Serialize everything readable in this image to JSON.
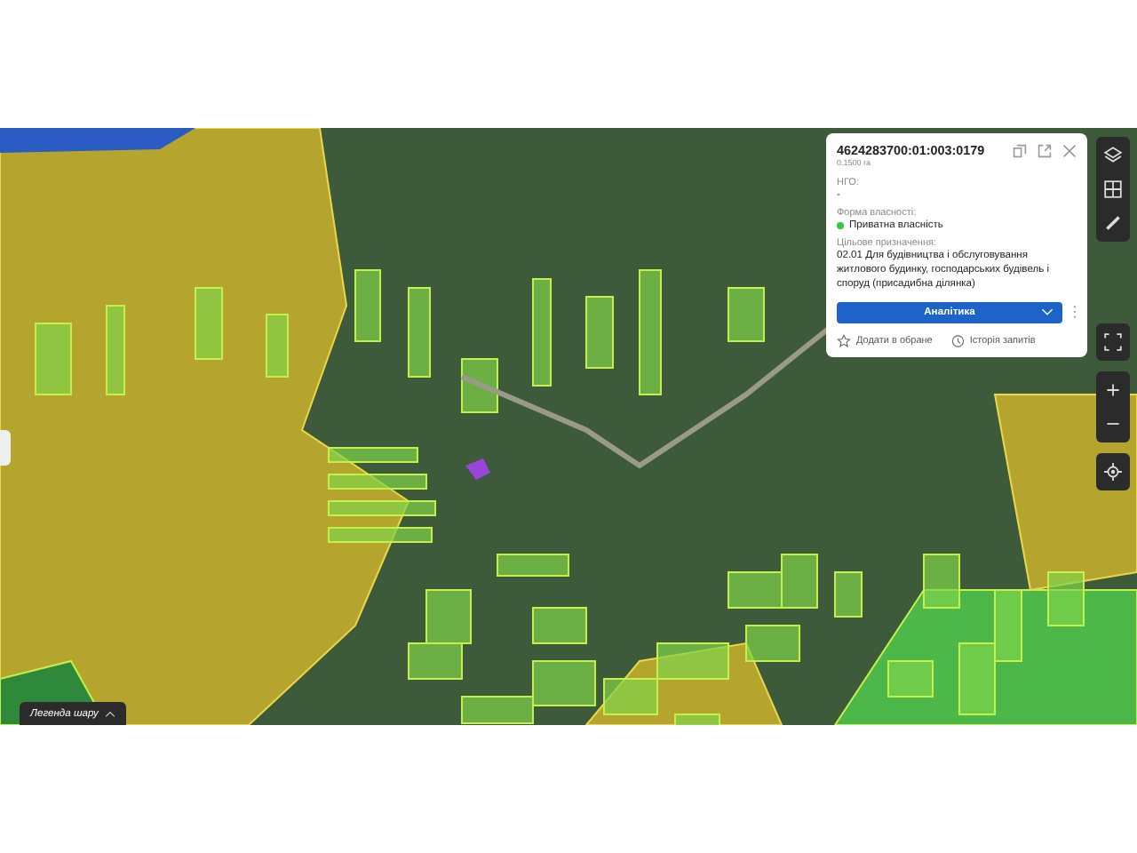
{
  "parcel": {
    "cadastral_number": "4624283700:01:003:0179",
    "area": "0.1500 га",
    "ngo_label": "НГО:",
    "ngo_value": "-",
    "ownership_label": "Форма власності:",
    "ownership_value": "Приватна власність",
    "purpose_label": "Цільове призначення:",
    "purpose_value": "02.01 Для будівництва і обслуговування житлового будинку, господарських будівель і споруд (присадибна ділянка)",
    "analytics_button": "Аналітика",
    "actions": [
      {
        "kind": "favorite",
        "label": "Додати в обране"
      },
      {
        "kind": "history",
        "label": "Історія запитів"
      }
    ]
  },
  "legend": {
    "label": "Легенда шару"
  }
}
